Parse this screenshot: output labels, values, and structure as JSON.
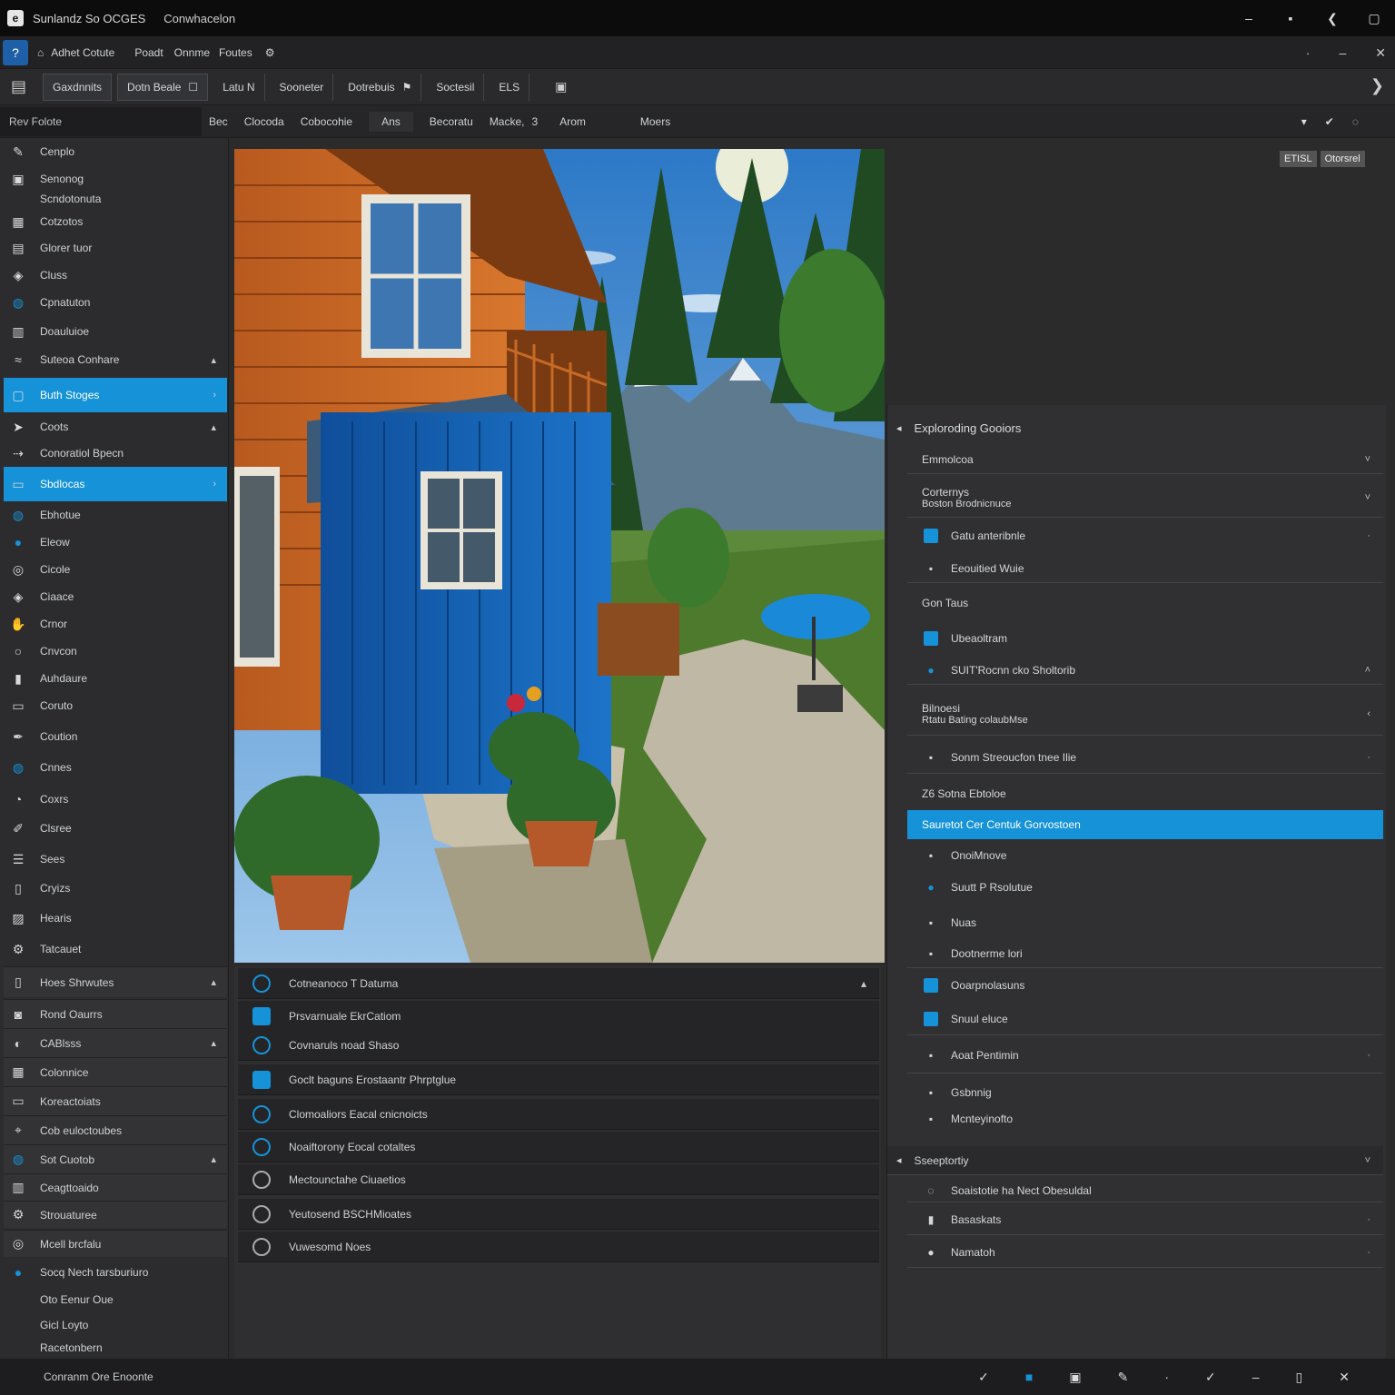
{
  "window": {
    "title": "Sunlandz So OCGES",
    "subtitle": "Conwhacelon",
    "controls": [
      "–",
      "▪",
      "❮",
      "▢"
    ]
  },
  "menubar": {
    "items": [
      "Adhet Cotute",
      "Poadt",
      "Onnme",
      "Foutes"
    ]
  },
  "toolbar": {
    "buttons": [
      "Gaxdnnits",
      "Dotn Beale",
      "Latu N",
      "Sooneter",
      "Dotrebuis",
      "Soctesil",
      "ELS"
    ]
  },
  "subbar": {
    "search_text": "Rev Folote",
    "items": [
      "Bec",
      "Clocoda",
      "Cobocohie",
      "Ans",
      "Becoratu",
      "Macke,",
      "3",
      "Arom",
      "Moers"
    ],
    "right_icons": [
      "▾",
      "✔",
      "◌"
    ]
  },
  "sidebar": {
    "items": [
      {
        "label": "Cenplo",
        "icon": "brush-icon"
      },
      {
        "label": "Senonog",
        "icon": "save-icon"
      },
      {
        "label": "Scndotonuta",
        "icon": ""
      },
      {
        "label": "Cotzotos",
        "icon": "grid-icon"
      },
      {
        "label": "Glorer tuor",
        "icon": "layers-icon"
      },
      {
        "label": "Cluss",
        "icon": "shield-icon"
      },
      {
        "label": "Cpnatuton",
        "icon": "globe-icon"
      },
      {
        "label": "Doauluioe",
        "icon": "db-icon"
      },
      {
        "label": "Suteoa Conhare",
        "icon": "wave-icon"
      },
      {
        "label": "Buth Stoges",
        "icon": "square-icon"
      },
      {
        "label": "Coots",
        "icon": "cursor-icon"
      },
      {
        "label": "Conoratiol Bpecn",
        "icon": "arrow-icon"
      },
      {
        "label": "Sbdlocas",
        "icon": "frame-icon"
      },
      {
        "label": "Ebhotue",
        "icon": "globe-icon"
      },
      {
        "label": "Eleow",
        "icon": "dot-icon"
      },
      {
        "label": "Cicole",
        "icon": "target-icon"
      },
      {
        "label": "Ciaace",
        "icon": "shield-icon"
      },
      {
        "label": "Crnor",
        "icon": "hand-icon"
      },
      {
        "label": "Cnvcon",
        "icon": "ring-icon"
      },
      {
        "label": "Auhdaure",
        "icon": "phone-icon"
      },
      {
        "label": "Coruto",
        "icon": "monitor-icon"
      },
      {
        "label": "Coution",
        "icon": "pen-icon"
      },
      {
        "label": "Cnnes",
        "icon": "globe-icon"
      },
      {
        "label": "Coxrs",
        "icon": "pie-icon"
      },
      {
        "label": "Clsree",
        "icon": "paint-icon"
      },
      {
        "label": "Sees",
        "icon": "stack-icon"
      },
      {
        "label": "Cryizs",
        "icon": "doc-icon"
      },
      {
        "label": "Hearis",
        "icon": "chart-icon"
      },
      {
        "label": "Tatcauet",
        "icon": "gear-icon"
      },
      {
        "label": "Hoes Shrwutes",
        "icon": "doc-icon"
      },
      {
        "label": "Rond Oaurrs",
        "icon": "camera-icon"
      },
      {
        "label": "CABlsss",
        "icon": "circle-icon"
      },
      {
        "label": "Colonnice",
        "icon": "grid-icon"
      },
      {
        "label": "Koreactoiats",
        "icon": "monitor-icon"
      },
      {
        "label": "Cob euloctoubes",
        "icon": "pin-icon"
      },
      {
        "label": "Sot Cuotob",
        "icon": "globe-icon"
      },
      {
        "label": "Ceagttoaido",
        "icon": "bars-icon"
      },
      {
        "label": "Strouaturee",
        "icon": "gear-icon"
      },
      {
        "label": "Mcell brcfalu",
        "icon": "target-icon"
      },
      {
        "label": "Socq Nech tarsburiuro",
        "icon": "dot-icon"
      },
      {
        "label": "Oto Eenur Oue",
        "icon": ""
      },
      {
        "label": "Gicl Loyto",
        "icon": ""
      },
      {
        "label": "Racetonbern",
        "icon": ""
      }
    ]
  },
  "photo": {
    "badge_1": "ETISL",
    "badge_2": "Otorsrel"
  },
  "bottom_list": {
    "items": [
      "Cotneanoco T Datuma",
      "Prsvarnuale EkrCatiom",
      "Covnaruls noad Shaso",
      "Goclt baguns Erostaantr Phrptglue",
      "Clomoaliors Eacal cnicnoicts",
      "Noaiftorony Eocal cotaltes",
      "Mectounctahe Ciuaetios",
      "Yeutosend BSCHMioates",
      "Vuwesomd Noes"
    ]
  },
  "right_panel": {
    "header": "Exploroding Gooiors",
    "rows": [
      {
        "label": "Emmolcoa"
      },
      {
        "label": "Corternys",
        "sub": "Boston Brodnicnuce"
      },
      {
        "label": "Gatu anteribnle"
      },
      {
        "label": "Eeouitied Wuie"
      },
      {
        "label": "Gon Taus"
      },
      {
        "label": "Ubeaoltram"
      },
      {
        "label": "SUIT'Rocnn cko Sholtorib"
      },
      {
        "label": "Bilnoesi",
        "sub": "Rtatu Bating colaubMse"
      },
      {
        "label": "Sonm Streoucfon tnee Ilie"
      },
      {
        "label": "Z6 Sotna Ebtoloe"
      },
      {
        "label": "Sauretot Cer Centuk Gorvostoen"
      },
      {
        "label": "OnoiMnove"
      },
      {
        "label": "Suutt P Rsolutue"
      },
      {
        "label": "Nuas"
      },
      {
        "label": "Dootnerme lori"
      },
      {
        "label": "Ooarpnolasuns"
      },
      {
        "label": "Snuul eluce"
      },
      {
        "label": "Aoat Pentimin"
      },
      {
        "label": "Gsbnnig"
      },
      {
        "label": "Mcnteyinofto"
      }
    ],
    "section2_header": "Sseeptortiy",
    "section2_rows": [
      "Soaistotie ha Nect Obesuldal",
      "Basaskats",
      "Namatoh"
    ]
  },
  "statusbar": {
    "text": "Conranm Ore Enoonte"
  },
  "colors": {
    "accent": "#1592d8",
    "background": "#2b2b2c",
    "titlebar": "#0c0c0d"
  }
}
